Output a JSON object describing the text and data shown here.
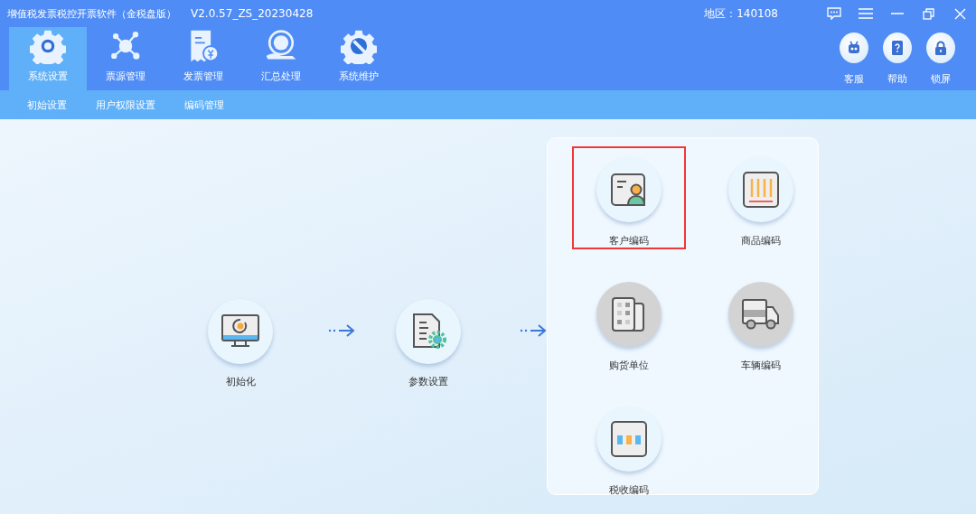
{
  "window": {
    "title": "增值税发票税控开票软件（金税盘版）",
    "version": "V2.0.57_ZS_20230428",
    "region": "地区：140108"
  },
  "main_tabs": [
    {
      "label": "系统设置",
      "kind": "gear",
      "selected": true
    },
    {
      "label": "票源管理",
      "kind": "network",
      "selected": false
    },
    {
      "label": "发票管理",
      "kind": "invoice",
      "selected": false
    },
    {
      "label": "汇总处理",
      "kind": "tax",
      "selected": false
    },
    {
      "label": "系统维护",
      "kind": "wrench",
      "selected": false
    }
  ],
  "tools": [
    {
      "label": "客服",
      "kind": "robot"
    },
    {
      "label": "帮助",
      "kind": "help"
    },
    {
      "label": "锁屏",
      "kind": "lock"
    }
  ],
  "sub_tabs": [
    "初始设置",
    "用户权限设置",
    "编码管理"
  ],
  "flow": [
    {
      "label": "初始化",
      "kind": "monitor"
    },
    {
      "label": "参数设置",
      "kind": "doc"
    }
  ],
  "codes": [
    {
      "label": "客户编码",
      "kind": "customer",
      "disabled": false,
      "highlighted": true
    },
    {
      "label": "商品编码",
      "kind": "goods",
      "disabled": false,
      "highlighted": false
    },
    {
      "label": "购货单位",
      "kind": "building",
      "disabled": true,
      "highlighted": false
    },
    {
      "label": "车辆编码",
      "kind": "truck",
      "disabled": true,
      "highlighted": false
    },
    {
      "label": "税收编码",
      "kind": "numbers",
      "disabled": false,
      "highlighted": false
    }
  ]
}
